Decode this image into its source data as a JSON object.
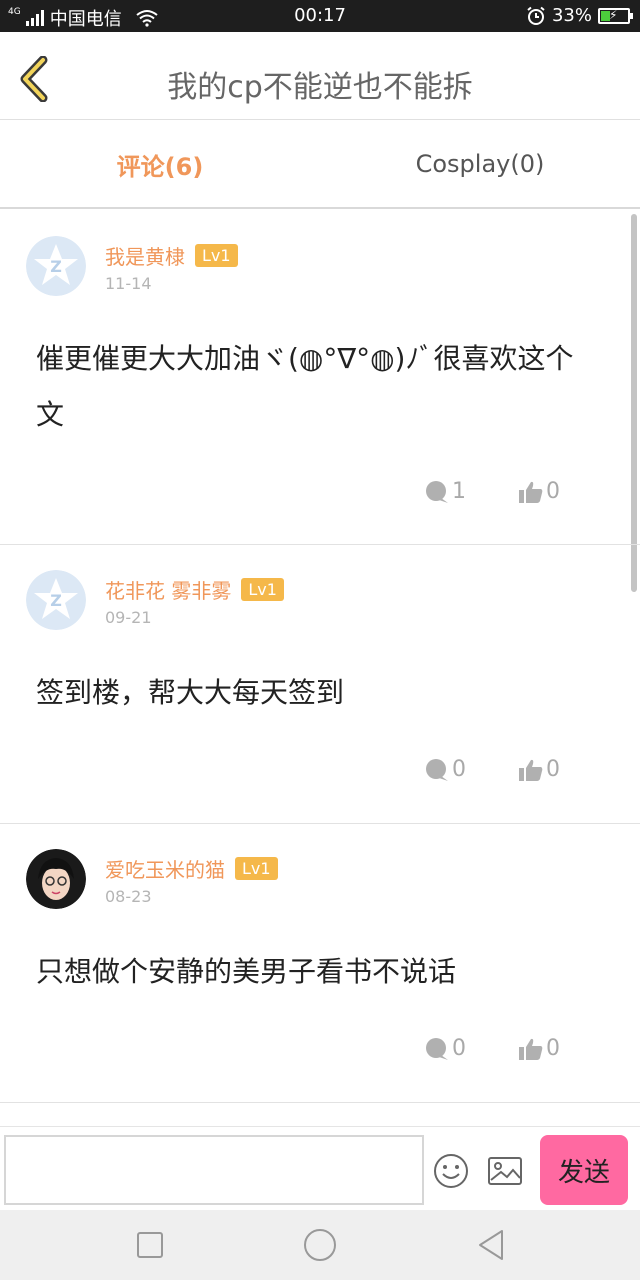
{
  "status_bar": {
    "network": "4G",
    "carrier": "中国电信",
    "time": "00:17",
    "battery": "33%",
    "battery_level": 0.33,
    "icons": [
      "signal-icon",
      "wifi-icon",
      "alarm-icon",
      "battery-icon"
    ]
  },
  "header": {
    "title": "我的cp不能逆也不能拆",
    "back_icon": "chevron-left-icon"
  },
  "tabs": [
    {
      "label": "评论(6)",
      "active": true
    },
    {
      "label": "Cosplay(0)",
      "active": false
    }
  ],
  "comments": [
    {
      "user": "我是黄棣",
      "level": "Lv1",
      "date": "11-14",
      "text": "催更催更大大加油ヾ(◍°∇°◍)ﾉﾞ很喜欢这个文",
      "replies": "1",
      "likes": "0",
      "avatar": "qq-default-avatar-icon"
    },
    {
      "user": "花非花 雾非雾",
      "level": "Lv1",
      "date": "09-21",
      "text": "签到楼，帮大大每天签到",
      "replies": "0",
      "likes": "0",
      "avatar": "qq-default-avatar-icon"
    },
    {
      "user": "爱吃玉米的猫",
      "level": "Lv1",
      "date": "08-23",
      "text": "只想做个安静的美男子看书不说话",
      "replies": "0",
      "likes": "0",
      "avatar": "user-photo-avatar"
    }
  ],
  "composer": {
    "value": "",
    "send_label": "发送",
    "icons": [
      "emoji-icon",
      "image-icon"
    ]
  },
  "nav": {
    "icons": [
      "recent-apps-icon",
      "home-icon",
      "back-triangle-icon"
    ]
  },
  "colors": {
    "accent": "#f0975a",
    "level_badge": "#f5b84a",
    "send_button": "#ff69a1",
    "status_bar": "#1e1e1e"
  }
}
